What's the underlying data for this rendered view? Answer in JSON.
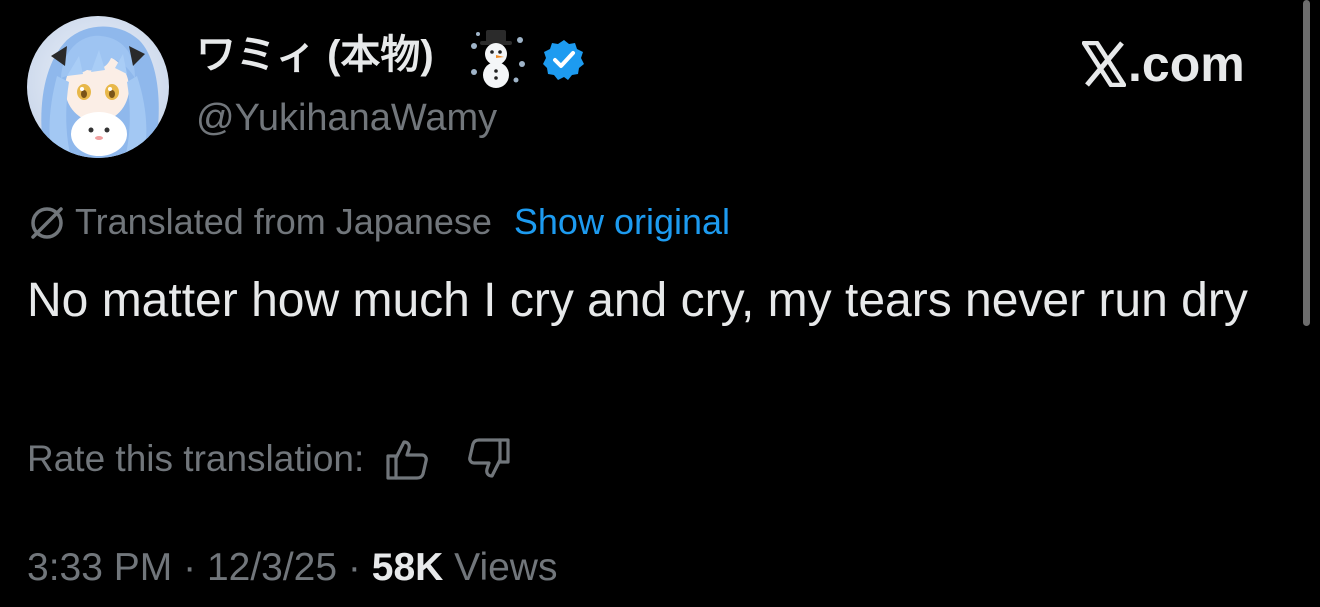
{
  "author": {
    "display_name": "ワミィ (本物)",
    "handle": "@YukihanaWamy",
    "name_emoji": "snowman-emoji",
    "verified": true,
    "verified_color": "#1d9bf0",
    "avatar": "avatar-anime-girl-icon"
  },
  "brand": {
    "domain_text": ".com",
    "logo": "x-logo-icon"
  },
  "translation": {
    "label": "Translated from Japanese",
    "show_original": "Show original",
    "rate_label": "Rate this translation:",
    "thumbs_up_icon": "thumbs-up-icon",
    "thumbs_down_icon": "thumbs-down-icon"
  },
  "tweet": {
    "text": "No matter how much I cry and cry, my tears never run dry"
  },
  "meta": {
    "time": "3:33 PM",
    "date": "12/3/25",
    "separator": "·",
    "views_count": "58K",
    "views_label": "Views"
  },
  "colors": {
    "background": "#000000",
    "text_primary": "#e7e9ea",
    "text_secondary": "#71767b",
    "link": "#1d9bf0"
  }
}
